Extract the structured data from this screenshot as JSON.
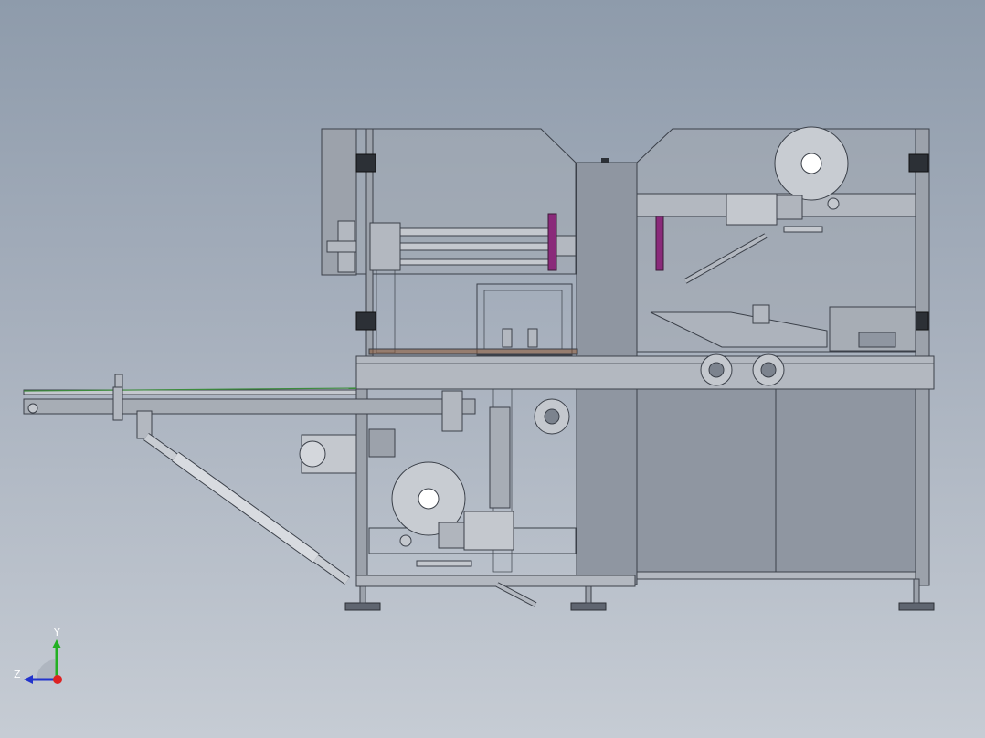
{
  "viewport": {
    "background_top": "#8e9bab",
    "background_bottom": "#c6ccd4"
  },
  "model": {
    "frame_color": "#9ca2ab",
    "panel_color": "#8f96a1",
    "edge_color": "#3b4049",
    "accent_color": "#8a2a7a",
    "belt_highlight": "#3d8c3d"
  },
  "triad": {
    "y_label": "Y",
    "z_label": "Z",
    "y_color": "#22b022",
    "z_color": "#2233cc",
    "x_color": "#dd2222"
  }
}
